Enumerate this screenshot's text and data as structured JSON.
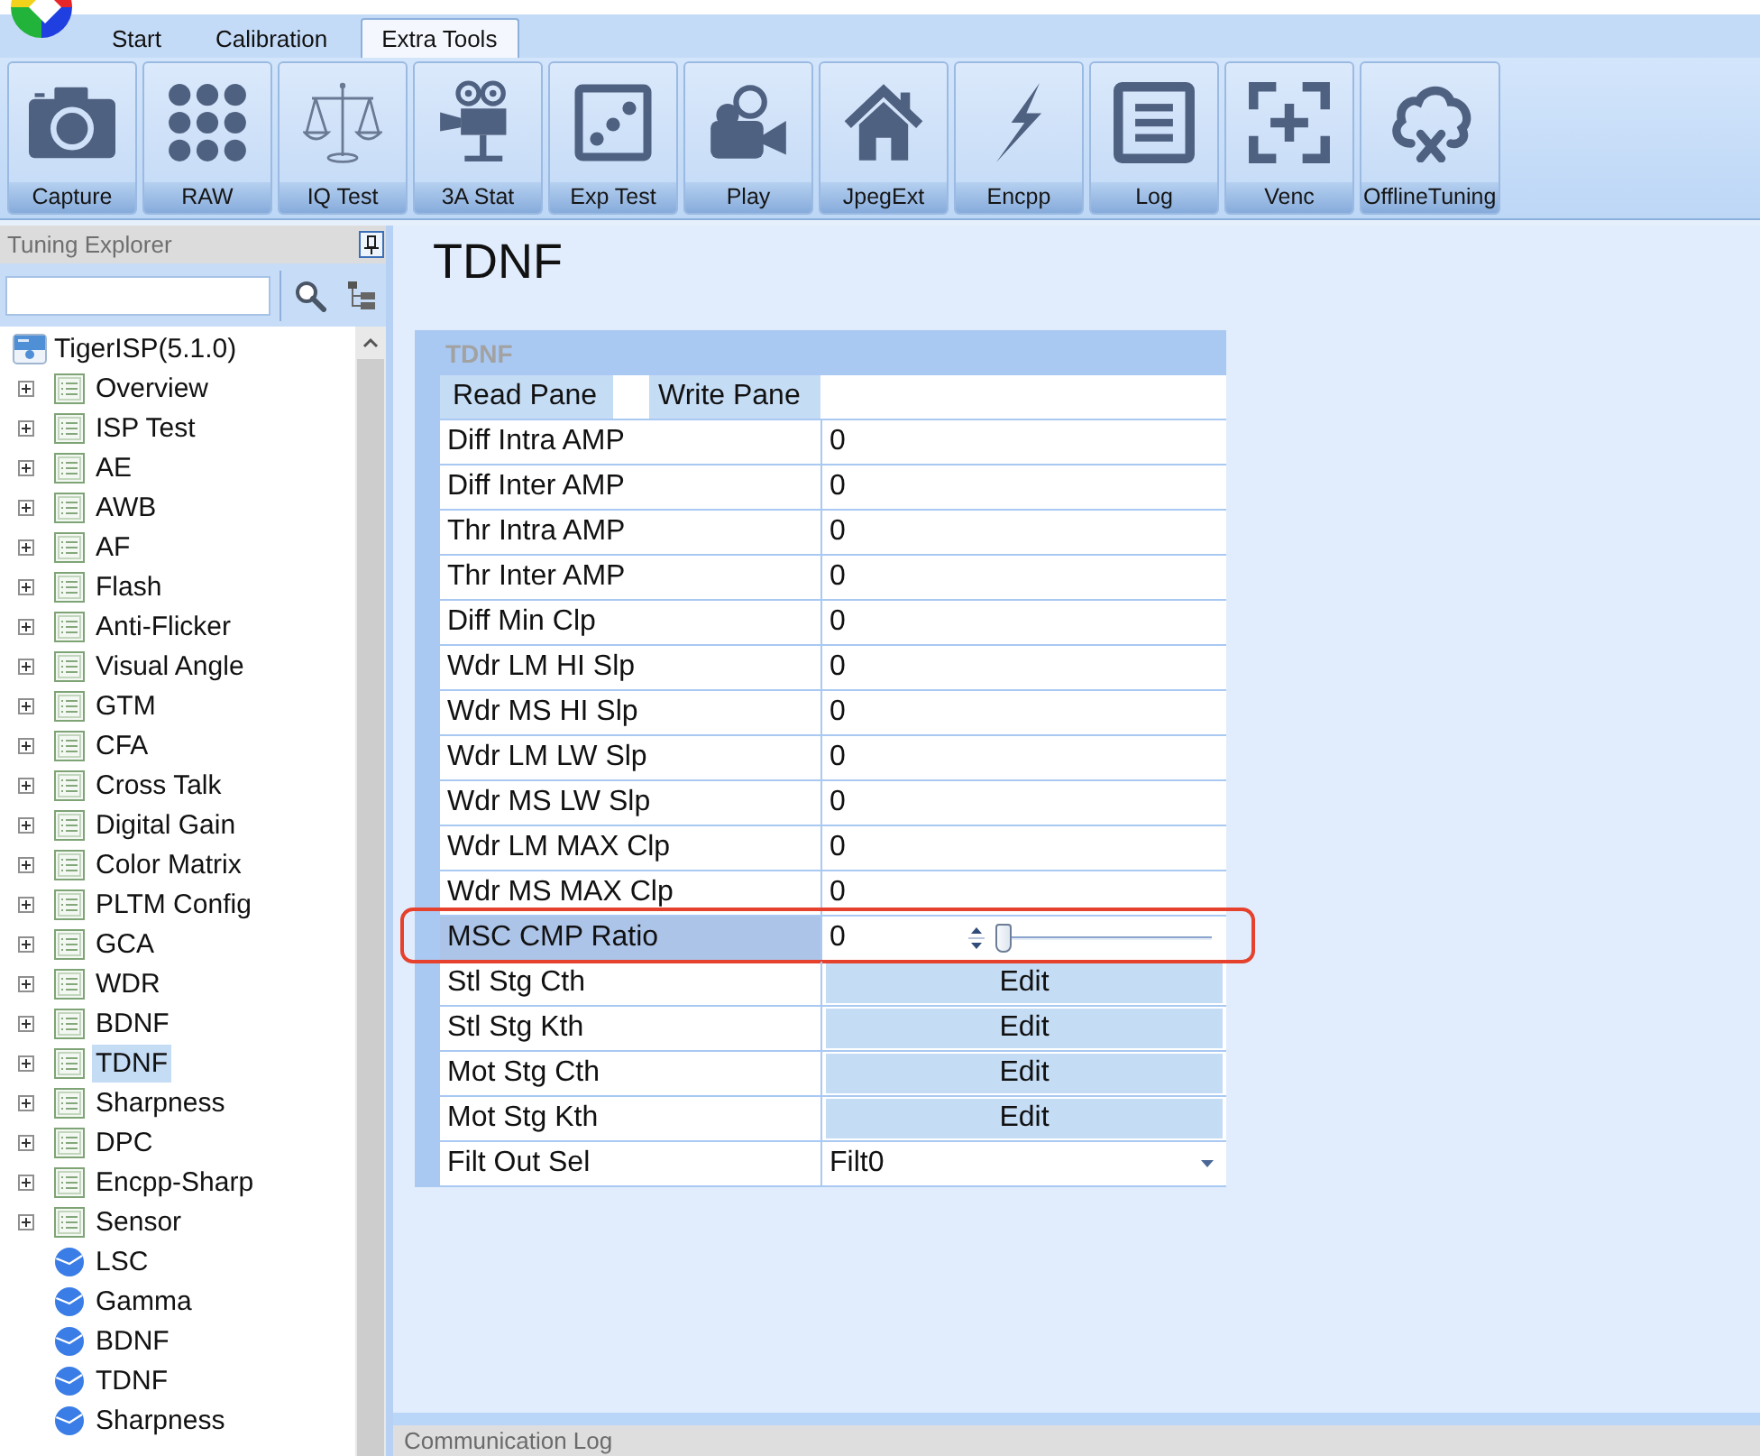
{
  "app_tabs": [
    {
      "label": "Start",
      "selected": false
    },
    {
      "label": "Calibration",
      "selected": false
    },
    {
      "label": "Extra Tools",
      "selected": true
    }
  ],
  "toolbar": [
    "Capture",
    "RAW",
    "IQ Test",
    "3A Stat",
    "Exp Test",
    "Play",
    "JpegExt",
    "Encpp",
    "Log",
    "Venc",
    "OfflineTuning"
  ],
  "explorer": {
    "title": "Tuning Explorer",
    "tree": {
      "label": "TigerISP(5.1.0)",
      "children": [
        {
          "label": "Overview",
          "kind": "module",
          "expanded": false,
          "selected": false
        },
        {
          "label": "ISP Test",
          "kind": "module",
          "expanded": false,
          "selected": false
        },
        {
          "label": "AE",
          "kind": "module",
          "expanded": false,
          "selected": false
        },
        {
          "label": "AWB",
          "kind": "module",
          "expanded": false,
          "selected": false
        },
        {
          "label": "AF",
          "kind": "module",
          "expanded": false,
          "selected": false
        },
        {
          "label": "Flash",
          "kind": "module",
          "expanded": false,
          "selected": false
        },
        {
          "label": "Anti-Flicker",
          "kind": "module",
          "expanded": false,
          "selected": false
        },
        {
          "label": "Visual Angle",
          "kind": "module",
          "expanded": false,
          "selected": false
        },
        {
          "label": "GTM",
          "kind": "module",
          "expanded": false,
          "selected": false
        },
        {
          "label": "CFA",
          "kind": "module",
          "expanded": false,
          "selected": false
        },
        {
          "label": "Cross Talk",
          "kind": "module",
          "expanded": false,
          "selected": false
        },
        {
          "label": "Digital Gain",
          "kind": "module",
          "expanded": false,
          "selected": false
        },
        {
          "label": "Color Matrix",
          "kind": "module",
          "expanded": false,
          "selected": false
        },
        {
          "label": "PLTM Config",
          "kind": "module",
          "expanded": false,
          "selected": false
        },
        {
          "label": "GCA",
          "kind": "module",
          "expanded": false,
          "selected": false
        },
        {
          "label": "WDR",
          "kind": "module",
          "expanded": false,
          "selected": false
        },
        {
          "label": "BDNF",
          "kind": "module",
          "expanded": false,
          "selected": false
        },
        {
          "label": "TDNF",
          "kind": "module",
          "expanded": false,
          "selected": true
        },
        {
          "label": "Sharpness",
          "kind": "module",
          "expanded": false,
          "selected": false
        },
        {
          "label": "DPC",
          "kind": "module",
          "expanded": false,
          "selected": false
        },
        {
          "label": "Encpp-Sharp",
          "kind": "module",
          "expanded": false,
          "selected": false
        },
        {
          "label": "Sensor",
          "kind": "module",
          "expanded": false,
          "selected": false
        },
        {
          "label": "LSC",
          "kind": "chart",
          "selected": false
        },
        {
          "label": "Gamma",
          "kind": "chart",
          "selected": false
        },
        {
          "label": "BDNF",
          "kind": "chart",
          "selected": false
        },
        {
          "label": "TDNF",
          "kind": "chart",
          "selected": false
        },
        {
          "label": "Sharpness",
          "kind": "chart",
          "selected": false
        }
      ]
    }
  },
  "page": {
    "title": "TDNF",
    "panel": {
      "title": "TDNF",
      "pane_buttons": [
        "Read Pane",
        "Write Pane"
      ],
      "rows": [
        {
          "label": "Diff Intra AMP",
          "kind": "number",
          "value": "0",
          "selected": false,
          "outlined": false
        },
        {
          "label": "Diff Inter AMP",
          "kind": "number",
          "value": "0",
          "selected": false,
          "outlined": false
        },
        {
          "label": "Thr Intra AMP",
          "kind": "number",
          "value": "0",
          "selected": false,
          "outlined": false
        },
        {
          "label": "Thr Inter AMP",
          "kind": "number",
          "value": "0",
          "selected": false,
          "outlined": false
        },
        {
          "label": "Diff Min Clp",
          "kind": "number",
          "value": "0",
          "selected": false,
          "outlined": false
        },
        {
          "label": "Wdr LM HI Slp",
          "kind": "number",
          "value": "0",
          "selected": false,
          "outlined": false
        },
        {
          "label": "Wdr MS HI Slp",
          "kind": "number",
          "value": "0",
          "selected": false,
          "outlined": false
        },
        {
          "label": "Wdr LM LW Slp",
          "kind": "number",
          "value": "0",
          "selected": false,
          "outlined": false
        },
        {
          "label": "Wdr MS LW Slp",
          "kind": "number",
          "value": "0",
          "selected": false,
          "outlined": false
        },
        {
          "label": "Wdr LM MAX Clp",
          "kind": "number",
          "value": "0",
          "selected": false,
          "outlined": false
        },
        {
          "label": "Wdr MS MAX Clp",
          "kind": "number",
          "value": "0",
          "selected": false,
          "outlined": false
        },
        {
          "label": "MSC CMP Ratio",
          "kind": "slider",
          "value": "0",
          "level": 0,
          "selected": true,
          "outlined": true
        },
        {
          "label": "Stl Stg Cth",
          "kind": "button",
          "button": "Edit",
          "selected": false,
          "outlined": false
        },
        {
          "label": "Stl Stg Kth",
          "kind": "button",
          "button": "Edit",
          "selected": false,
          "outlined": false
        },
        {
          "label": "Mot Stg Cth",
          "kind": "button",
          "button": "Edit",
          "selected": false,
          "outlined": false
        },
        {
          "label": "Mot Stg Kth",
          "kind": "button",
          "button": "Edit",
          "selected": false,
          "outlined": false
        },
        {
          "label": "Filt Out Sel",
          "kind": "dropdown",
          "value": "Filt0",
          "selected": false,
          "outlined": false
        }
      ]
    }
  },
  "communication_log": {
    "title": "Communication Log"
  }
}
